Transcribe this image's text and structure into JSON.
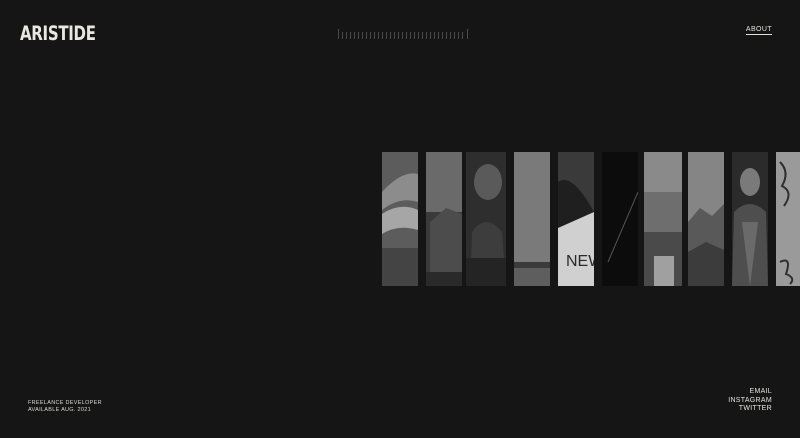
{
  "header": {
    "logo": "ARISTIDE",
    "about_link": "ABOUT"
  },
  "gallery": {
    "strip_count": 10,
    "strip_texts": [
      "NEW"
    ]
  },
  "footer": {
    "role": "FREELANCE DEVELOPER",
    "availability": "AVAILABLE AUG. 2021",
    "social_links": [
      "EMAIL",
      "INSTAGRAM",
      "TWITTER"
    ]
  },
  "colors": {
    "background": "#151515",
    "text": "#e2e2dc"
  },
  "icons": [
    "tick-ruler-icon"
  ]
}
